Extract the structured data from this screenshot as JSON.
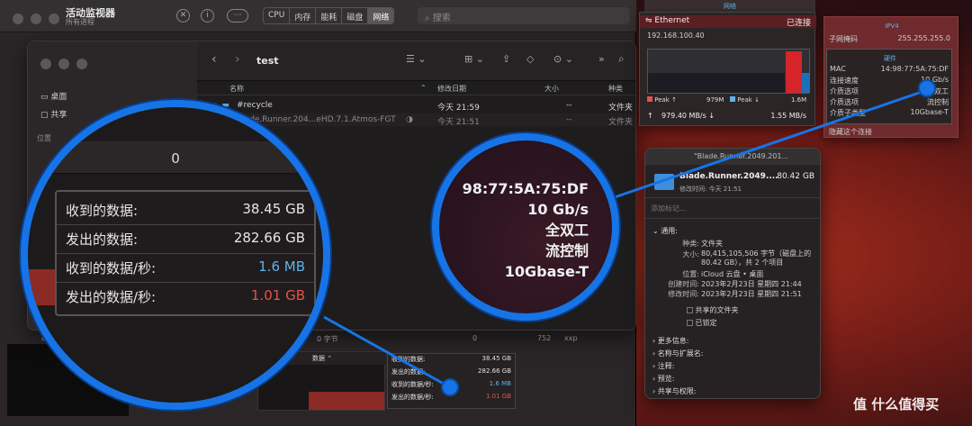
{
  "activity_monitor": {
    "title": "活动监视器",
    "subtitle": "所有进程",
    "tabs": [
      "CPU",
      "内存",
      "能耗",
      "磁盘",
      "网络"
    ],
    "active_tab": "网络",
    "search_placeholder": "搜索",
    "bottom_row": {
      "a": "a",
      "bytes": "0 字节",
      "zero": "0",
      "num": "752",
      "name": "xxp"
    },
    "graph_label": "数据",
    "stats": [
      {
        "label": "收到的数据:",
        "value": "38.45 GB",
        "color": "#e0e0e0"
      },
      {
        "label": "发出的数据:",
        "value": "282.66 GB",
        "color": "#e0e0e0"
      },
      {
        "label": "收到的数据/秒:",
        "value": "1.6 MB",
        "color": "#5fb3e8"
      },
      {
        "label": "发出的数据/秒:",
        "value": "1.01 GB",
        "color": "#e5524b"
      }
    ]
  },
  "finder": {
    "folder": "test",
    "sidebar": [
      "桌面",
      "共享",
      "位置"
    ],
    "columns": {
      "name": "名称",
      "date": "修改日期",
      "size": "大小",
      "kind": "种类"
    },
    "rows": [
      {
        "name": "#recycle",
        "date": "今天 21:59",
        "size": "--",
        "kind": "文件夹"
      },
      {
        "name": "Blade.Runner.204...eHD.7.1.Atmos-FGT",
        "date": "今天 21:51",
        "size": "--",
        "kind": "文件夹"
      }
    ]
  },
  "magnifier1": {
    "header": "0",
    "stats": [
      {
        "label": "收到的数据:",
        "value": "38.45 GB",
        "color": "#e0e0e0"
      },
      {
        "label": "发出的数据:",
        "value": "282.66 GB",
        "color": "#e0e0e0"
      },
      {
        "label": "收到的数据/秒:",
        "value": "1.6 MB",
        "color": "#5fb3e8"
      },
      {
        "label": "发出的数据/秒:",
        "value": "1.01 GB",
        "color": "#e5524b"
      }
    ]
  },
  "magnifier2": {
    "lines": [
      "98:77:5A:75:DF",
      "10 Gb/s",
      "全双工",
      "流控制",
      "10Gbase-T"
    ]
  },
  "network_menu": {
    "menu_title": "网络",
    "interface": "Ethernet",
    "status": "已连接",
    "ip": "192.168.100.40",
    "peak_up": "Peak ↑",
    "peak_up_val": "979M",
    "peak_down": "Peak ↓",
    "peak_down_val": "1.6M",
    "rate_up": "979.40 MB/s ↓",
    "rate_down": "1.55 MB/s"
  },
  "ipv4_panel": {
    "section": "IPV4",
    "subnet_label": "子网掩码",
    "subnet": "255.255.255.0",
    "hw_section": "硬件",
    "mac_label": "MAC",
    "mac": "14:98:77:5A:75:DF",
    "speed_label": "连接速度",
    "speed": "10 Gb/s",
    "duplex_label": "介质选项",
    "duplex": "全双工",
    "flow_label": "介质选项",
    "flow": "流控制",
    "type_label": "介质子类型",
    "type": "10Gbase-T",
    "hide": "隐藏这个连接"
  },
  "info_window": {
    "title": "\"Blade.Runner.2049.201...",
    "name": "Blade.Runner.2049....",
    "size": "80.42 GB",
    "modified": "修改时间: 今天 21:51",
    "tag_placeholder": "添加标记...",
    "general": "通用:",
    "kind_label": "种类:",
    "kind": "文件夹",
    "size_label": "大小:",
    "size_full": "80,415,105,506 字节（磁盘上的 80.42 GB），共 2 个项目",
    "where_label": "位置:",
    "where": "iCloud 云盘 • 桌面",
    "created_label": "创建时间:",
    "created": "2023年2月23日 星期四 21:44",
    "mod_label": "修改时间:",
    "mod": "2023年2月23日 星期四 21:51",
    "shared": "共享的文件夹",
    "locked": "已锁定",
    "sections": [
      "更多信息:",
      "名称与扩展名:",
      "注释:",
      "预览:",
      "共享与权限:"
    ]
  },
  "watermark": "值 什么值得买"
}
